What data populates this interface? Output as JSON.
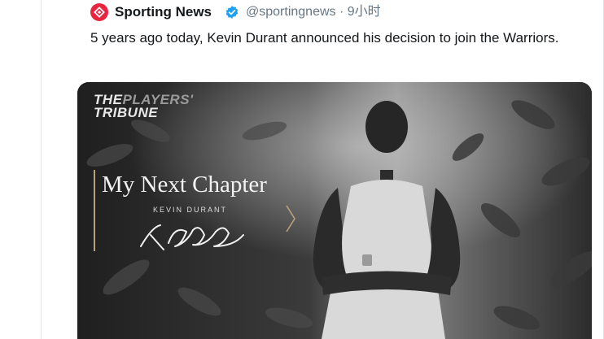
{
  "account": {
    "avatar_icon": "sporting-news-logo-icon",
    "name": "Sporting News",
    "verified_icon": "verified-badge-icon",
    "handle": "@sportingnews",
    "separator": " · ",
    "time": "9小时"
  },
  "tweet": {
    "text": "5 years ago today, Kevin Durant announced his decision to join the Warriors."
  },
  "media": {
    "brand_line1_a": "THE",
    "brand_line1_b": "PLAYERS'",
    "brand_line2": "TRIBUNE",
    "headline": "My Next Chapter",
    "byline": "KEVIN DURANT"
  },
  "colors": {
    "avatar": "#e8243e",
    "verified": "#1da1f2",
    "text": "#14171a",
    "muted": "#657786"
  }
}
